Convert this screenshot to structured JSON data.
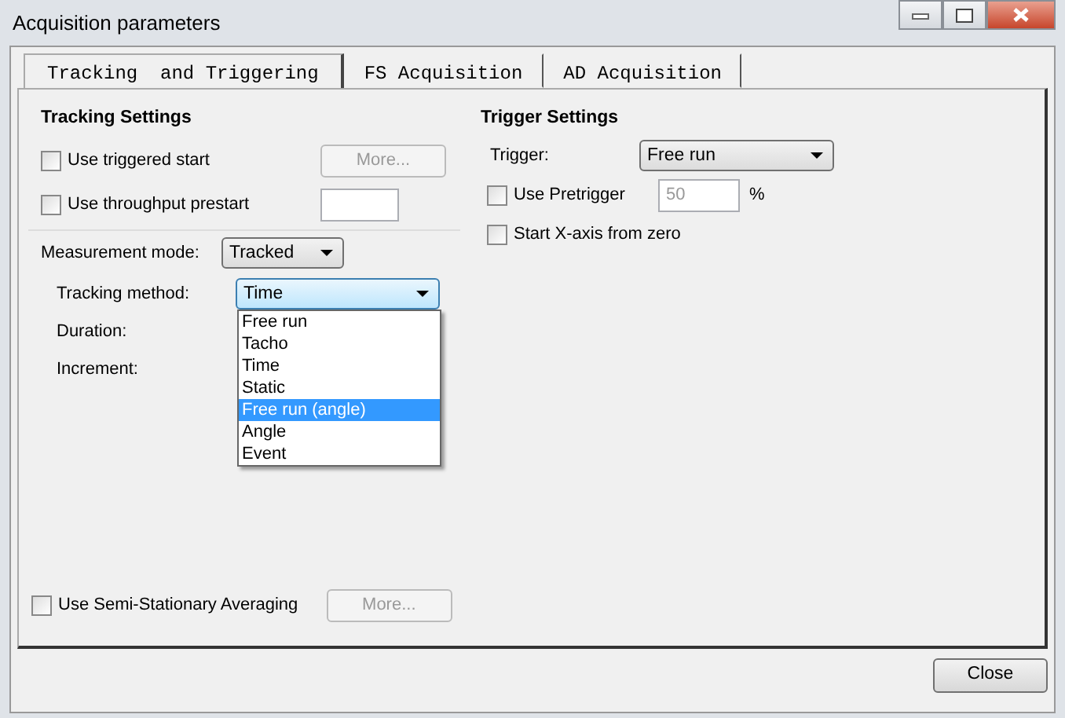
{
  "window": {
    "title": "Acquisition parameters"
  },
  "tabs": [
    {
      "label": "Tracking  and Triggering",
      "selected": true
    },
    {
      "label": "FS Acquisition",
      "selected": false
    },
    {
      "label": "AD Acquisition",
      "selected": false
    }
  ],
  "tracking_settings": {
    "title": "Tracking Settings",
    "triggered_start": {
      "label": "Use triggered start",
      "checked": false,
      "button": {
        "label": "More...",
        "disabled": true
      }
    },
    "throughput_prestart": {
      "label": "Use throughput prestart",
      "checked": false
    },
    "measurement_mode": {
      "label": "Measurement mode:",
      "value": "Tracked"
    },
    "tracking_method": {
      "label": "Tracking method:",
      "value": "Time",
      "expanded": true,
      "options": [
        {
          "label": "Free run",
          "highlighted": false
        },
        {
          "label": "Tacho",
          "highlighted": false
        },
        {
          "label": "Time",
          "highlighted": false
        },
        {
          "label": "Static",
          "highlighted": false
        },
        {
          "label": "Free run (angle)",
          "highlighted": true
        },
        {
          "label": "Angle",
          "highlighted": false
        },
        {
          "label": "Event",
          "highlighted": false
        }
      ]
    },
    "duration": {
      "label": "Duration:"
    },
    "increment": {
      "label": "Increment:"
    },
    "semi_stationary": {
      "label": "Use Semi-Stationary Averaging",
      "checked": false,
      "button": {
        "label": "More...",
        "disabled": true
      }
    }
  },
  "trigger_settings": {
    "title": "Trigger Settings",
    "trigger": {
      "label": "Trigger:",
      "value": "Free run"
    },
    "pretrigger": {
      "label": "Use Pretrigger",
      "checked": false,
      "value": "50",
      "unit": "%",
      "disabled": true
    },
    "start_x_zero": {
      "label": "Start X-axis from zero",
      "checked": false
    }
  },
  "close_button": {
    "label": "Close"
  }
}
